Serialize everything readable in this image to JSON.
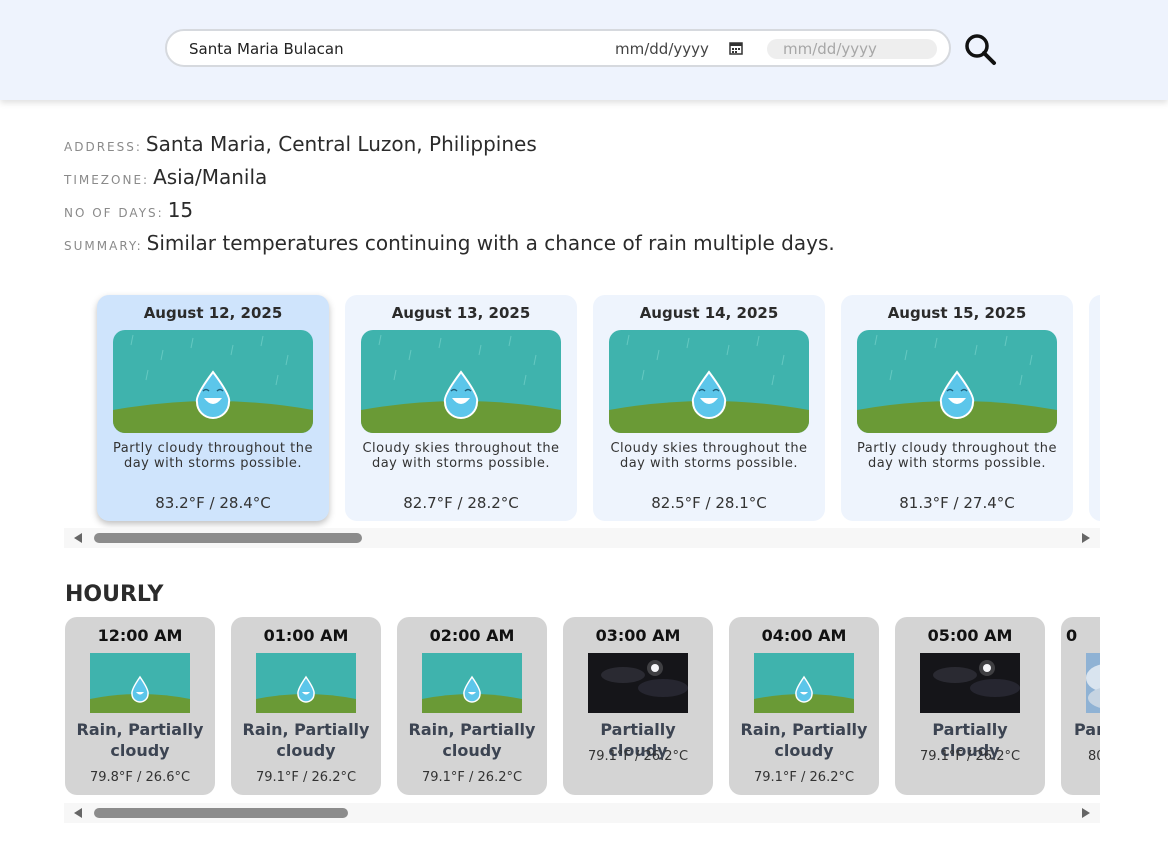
{
  "search": {
    "location_value": "Santa Maria Bulacan",
    "date_start_placeholder": "mm/dd/yyyy",
    "date_end_placeholder": "mm/dd/yyyy"
  },
  "info": {
    "address_label": "ADDRESS:",
    "address": "Santa Maria, Central Luzon, Philippines",
    "timezone_label": "TIMEZONE:",
    "timezone": "Asia/Manila",
    "days_label": "NO OF DAYS:",
    "days": "15",
    "summary_label": "SUMMARY:",
    "summary": "Similar temperatures continuing with a chance of rain multiple days."
  },
  "daily": [
    {
      "date": "August 12, 2025",
      "desc": "Partly cloudy throughout the day with storms possible.",
      "temp": "83.2°F / 28.4°C",
      "icon": "rain-drop-icon",
      "selected": true
    },
    {
      "date": "August 13, 2025",
      "desc": "Cloudy skies throughout the day with storms possible.",
      "temp": "82.7°F / 28.2°C",
      "icon": "rain-drop-icon"
    },
    {
      "date": "August 14, 2025",
      "desc": "Cloudy skies throughout the day with storms possible.",
      "temp": "82.5°F / 28.1°C",
      "icon": "rain-drop-icon"
    },
    {
      "date": "August 15, 2025",
      "desc": "Partly cloudy throughout the day with storms possible.",
      "temp": "81.3°F / 27.4°C",
      "icon": "rain-drop-icon"
    }
  ],
  "hourly_title": "HOURLY",
  "hourly": [
    {
      "time": "12:00 AM",
      "condition": "Rain, Partially cloudy",
      "temp": "79.8°F / 26.6°C",
      "icon": "rain-drop-icon"
    },
    {
      "time": "01:00 AM",
      "condition": "Rain, Partially cloudy",
      "temp": "79.1°F / 26.2°C",
      "icon": "rain-drop-icon"
    },
    {
      "time": "02:00 AM",
      "condition": "Rain, Partially cloudy",
      "temp": "79.1°F / 26.2°C",
      "icon": "rain-drop-icon"
    },
    {
      "time": "03:00 AM",
      "condition": "Partially cloudy",
      "temp": "79.1°F / 26.2°C",
      "icon": "cloudy-night-icon"
    },
    {
      "time": "04:00 AM",
      "condition": "Rain, Partially cloudy",
      "temp": "79.1°F / 26.2°C",
      "icon": "rain-drop-icon"
    },
    {
      "time": "05:00 AM",
      "condition": "Partially cloudy",
      "temp": "79.1°F / 26.2°C",
      "icon": "cloudy-night-icon"
    },
    {
      "time": "0",
      "condition": "Par",
      "temp": "80",
      "icon": "cloudy-day-icon"
    }
  ],
  "colors": {
    "header_bg": "#eef3fd",
    "card_bg": "#eef4fd",
    "card_selected_bg": "#cfe4fc",
    "hour_card_bg": "#d4d4d4",
    "rain_sky": "#3fb3ad",
    "grass": "#6a9a36",
    "night_sky": "#151519"
  }
}
